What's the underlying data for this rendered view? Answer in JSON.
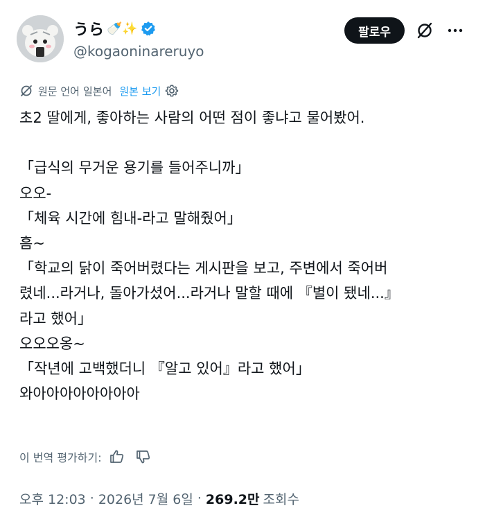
{
  "author": {
    "display_name": "うら",
    "emoji": "🍼✨",
    "handle": "@kogaoninareruyo",
    "verified": true
  },
  "actions": {
    "follow_label": "팔로우"
  },
  "translation": {
    "prefix": "원문 언어",
    "language": "일본어",
    "show_original": "원본 보기"
  },
  "post": {
    "lines": [
      "초2 딸에게, 좋아하는 사람의 어떤 점이 좋냐고 물어봤어.",
      "",
      "「급식의 무거운 용기를 들어주니까」",
      "오오-",
      "「체육 시간에 힘내-라고 말해줬어」",
      "흠~",
      "「학교의 닭이 죽어버렸다는 게시판을 보고, 주변에서 죽어버",
      "렸네...라거나, 돌아가셨어...라거나 말할 때에 『별이 됐네...』",
      "라고 했어」",
      "오오오옹~",
      "「작년에 고백했더니 『알고 있어』라고 했어」",
      "와아아아아아아아아"
    ]
  },
  "rate_translation": {
    "label": "이 번역 평가하기:"
  },
  "meta": {
    "time": "오후 12:03",
    "date": "2026년 7월 6일",
    "views_count": "269.2만",
    "views_label": "조회수"
  },
  "colors": {
    "text_primary": "#0f1419",
    "text_secondary": "#536471",
    "link_blue": "#1d9bf0",
    "verified_blue": "#1d9bf0",
    "follow_bg": "#0f1419"
  }
}
